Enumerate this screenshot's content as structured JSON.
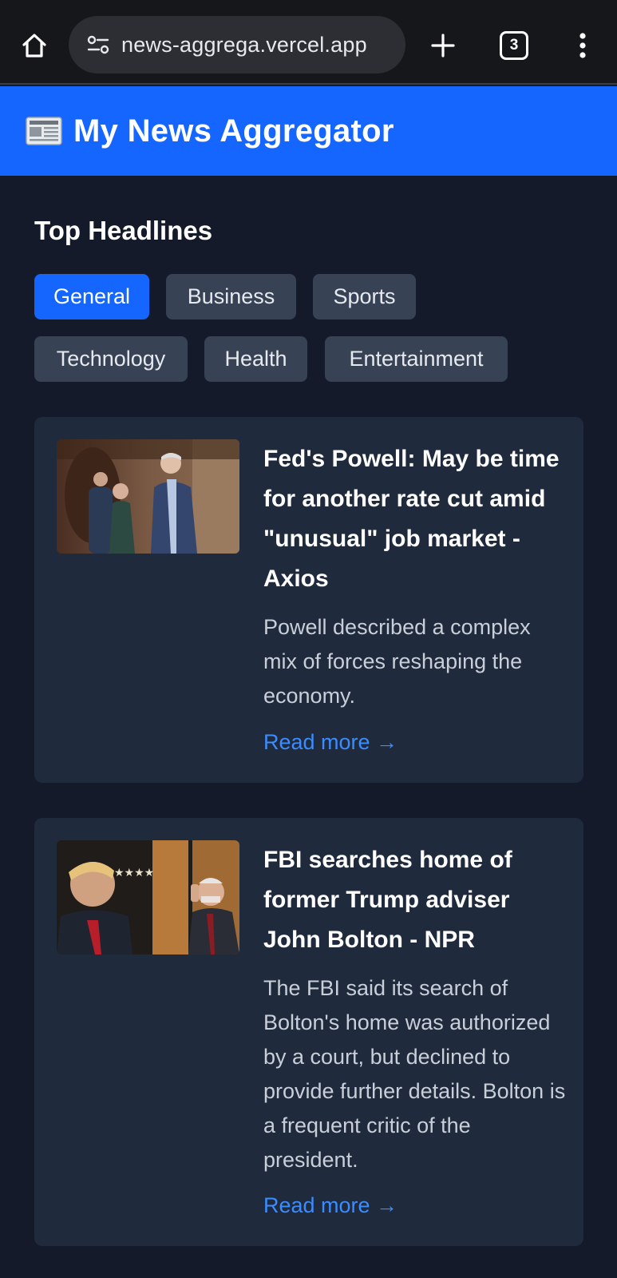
{
  "browser": {
    "url": "news-aggrega.vercel.app",
    "tab_count": "3",
    "icons": [
      "home-icon",
      "site-settings-icon",
      "plus-icon",
      "tab-switcher-icon",
      "more-vert-icon"
    ]
  },
  "header": {
    "icon": "newspaper-icon",
    "title": "My News Aggregator",
    "color": "#1565ff"
  },
  "main": {
    "section_title": "Top Headlines",
    "categories": [
      {
        "label": "General",
        "active": true
      },
      {
        "label": "Business",
        "active": false
      },
      {
        "label": "Sports",
        "active": false
      },
      {
        "label": "Technology",
        "active": false
      },
      {
        "label": "Health",
        "active": false
      },
      {
        "label": "Entertainment",
        "active": false
      }
    ],
    "articles": [
      {
        "title": "Fed's Powell: May be time for another rate cut amid \"unusual\" job market - Axios",
        "description": "Powell described a complex mix of forces reshaping the economy.",
        "link_text": "Read more →"
      },
      {
        "title": "FBI searches home of former Trump adviser John Bolton - NPR",
        "description": "The FBI said its search of Bolton's home was authorized by a court, but declined to provide further details. Bolton is a frequent critic of the president.",
        "link_text": "Read more →"
      }
    ]
  },
  "colors": {
    "background": "#141a2a",
    "card": "#1f2a3c",
    "chip": "#374254",
    "accent": "#1565ff",
    "link": "#3b8cff"
  }
}
